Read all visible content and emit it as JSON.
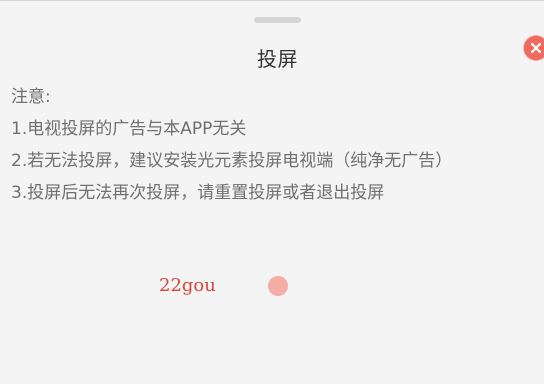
{
  "dialog": {
    "title": "投屏",
    "close_icon": "close-icon",
    "handle_icon": "drag-handle"
  },
  "notice": {
    "heading": "注意:",
    "items": [
      "1.电视投屏的广告与本APP无关",
      "2.若无法投屏，建议安装光元素投屏电视端（纯净无广告）",
      "3.投屏后无法再次投屏，请重置投屏或者退出投屏"
    ]
  },
  "watermark": {
    "text": "22gou"
  },
  "colors": {
    "background": "#f4f4f4",
    "close": "#ec6a5e",
    "watermark": "#d8453a",
    "watermark_dot": "#f4aca7"
  }
}
